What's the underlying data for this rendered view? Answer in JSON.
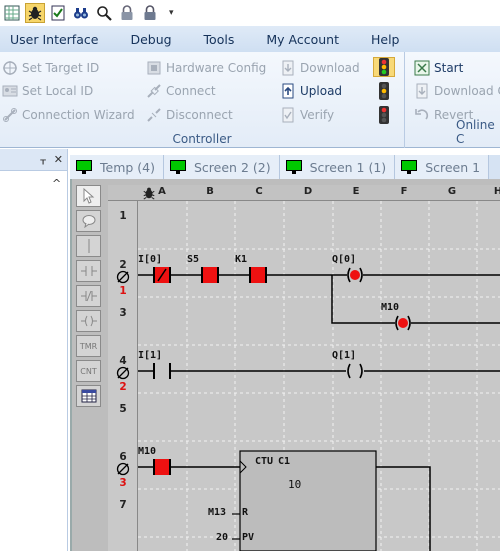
{
  "quick_access": {
    "icons": [
      "grid-icon",
      "bug-icon",
      "checklist-icon",
      "binoculars-icon",
      "magnifier-icon",
      "lock-icon",
      "lock-closed-icon"
    ],
    "dropdown_glyph": "▾"
  },
  "menu": {
    "items": [
      "User Interface",
      "Debug",
      "Tools",
      "My Account",
      "Help"
    ]
  },
  "ribbon": {
    "controller": {
      "caption": "Controller",
      "set_target_id": "Set Target  ID",
      "set_local_id": "Set Local  ID",
      "connection_wizard": "Connection Wizard",
      "hardware_config": "Hardware Config",
      "connect": "Connect",
      "disconnect": "Disconnect",
      "download": "Download",
      "upload": "Upload",
      "verify": "Verify"
    },
    "online": {
      "caption": "Online C",
      "start": "Start",
      "download": "Download C",
      "revert": "Revert"
    }
  },
  "left_panel": {
    "pin_glyph": "ᚁ",
    "close_glyph": "✕",
    "chevron_glyph": "^"
  },
  "tabs": [
    {
      "label": "Temp (4)"
    },
    {
      "label": "Screen 2 (2)"
    },
    {
      "label": "Screen 1 (1)"
    },
    {
      "label": "Screen 1"
    }
  ],
  "palette": {
    "items": [
      "arrow",
      "comment",
      "wire",
      "no-contact",
      "nc-contact",
      "coil",
      "TMR",
      "CNT",
      "table"
    ],
    "timer_label": "TMR",
    "counter_label": "CNT"
  },
  "ladder": {
    "columns": [
      "A",
      "B",
      "C",
      "D",
      "E",
      "F",
      "G",
      "H"
    ],
    "rows": [
      "1",
      "2",
      "3",
      "4",
      "5",
      "6",
      "7"
    ],
    "rung_numbers": [
      "1",
      "2",
      "3"
    ],
    "labels": {
      "i0": "I[0]",
      "s5": "S5",
      "k1": "K1",
      "q0": "Q[0]",
      "m10_coil": "M10",
      "i1": "I[1]",
      "q1": "Q[1]",
      "m10_contact": "M10",
      "ctu": "CTU",
      "c1": "C1",
      "preset_value": "10",
      "m13": "M13",
      "r_pin": "R",
      "pv_value": "20",
      "pv_pin": "PV"
    },
    "colors": {
      "active": "#e11",
      "grid_bg": "#c8c8c8",
      "block_fill": "#bcbcbc",
      "rung_number": "#d11"
    }
  }
}
